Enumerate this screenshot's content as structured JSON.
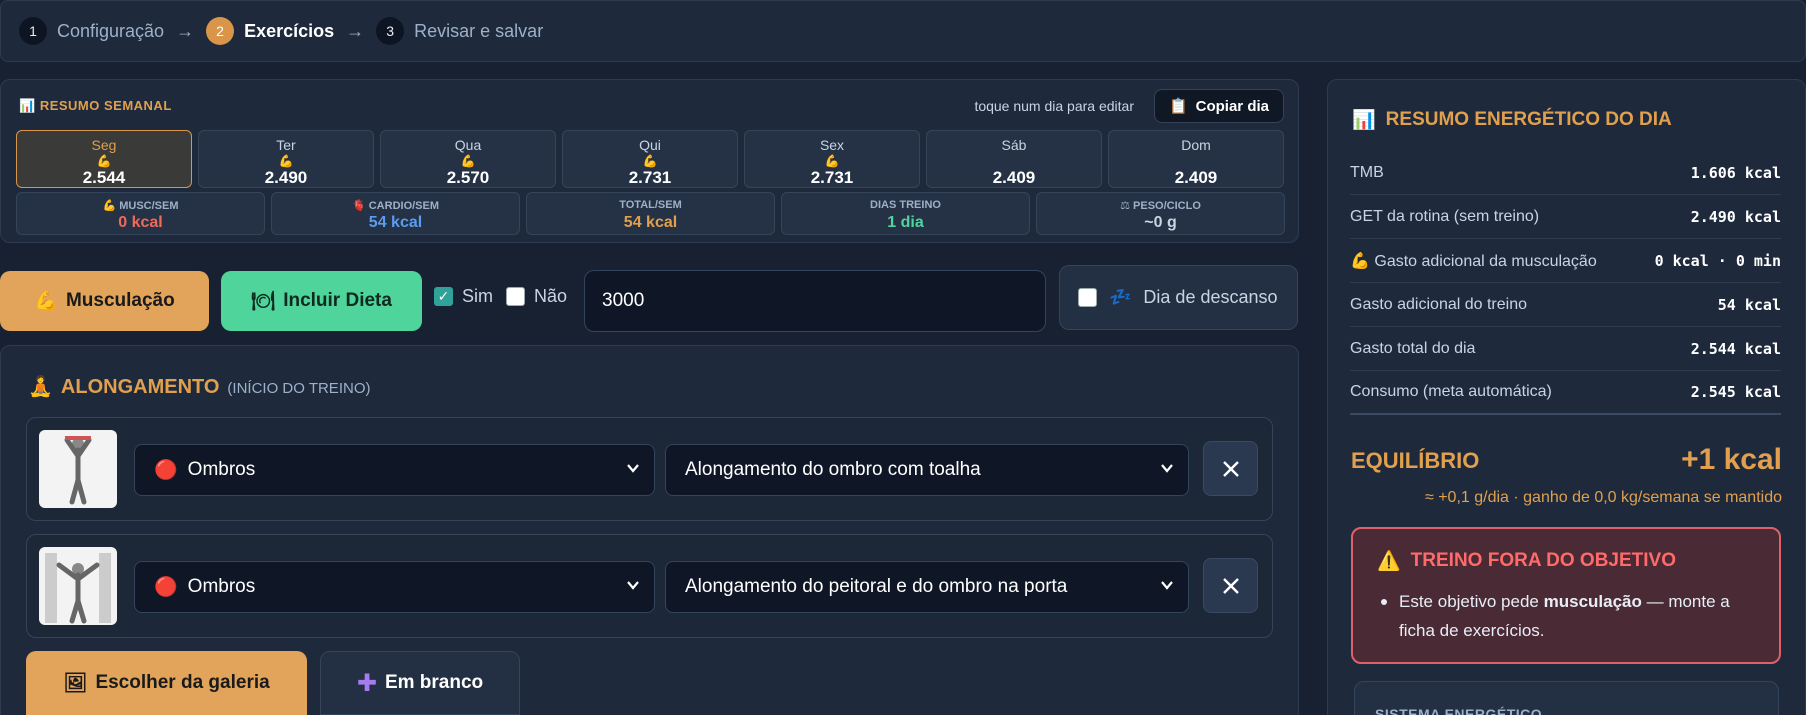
{
  "stepper": {
    "steps": [
      {
        "num": "1",
        "label": "Configuração"
      },
      {
        "num": "2",
        "label": "Exercícios"
      },
      {
        "num": "3",
        "label": "Revisar e salvar"
      }
    ],
    "arrow": "→"
  },
  "week": {
    "title": "RESUMO SEMANAL",
    "hint": "toque num dia para editar",
    "copy_label": "Copiar dia",
    "days": [
      {
        "name": "Seg",
        "kcal": "2.544",
        "has_icon": true
      },
      {
        "name": "Ter",
        "kcal": "2.490",
        "has_icon": true
      },
      {
        "name": "Qua",
        "kcal": "2.570",
        "has_icon": true
      },
      {
        "name": "Qui",
        "kcal": "2.731",
        "has_icon": true
      },
      {
        "name": "Sex",
        "kcal": "2.731",
        "has_icon": true
      },
      {
        "name": "Sáb",
        "kcal": "2.409",
        "has_icon": false
      },
      {
        "name": "Dom",
        "kcal": "2.409",
        "has_icon": false
      }
    ],
    "stats": [
      {
        "label": "MUSC/SEM",
        "value": "0 kcal",
        "color": "#f06a5a"
      },
      {
        "label": "CARDIO/SEM",
        "value": "54 kcal",
        "color": "#5a9cf0"
      },
      {
        "label": "TOTAL/SEM",
        "value": "54 kcal",
        "color": "#e0a04d"
      },
      {
        "label": "DIAS TREINO",
        "value": "1 dia",
        "color": "#4fd49c"
      },
      {
        "label": "PESO/CICLO",
        "value": "~0 g",
        "color": "#c9d4e2"
      }
    ]
  },
  "controls": {
    "musc_label": "Musculação",
    "diet_label": "Incluir Dieta",
    "yes_label": "Sim",
    "no_label": "Não",
    "calories_value": "3000",
    "rest_label": "Dia de descanso"
  },
  "exercise": {
    "title": "ALONGAMENTO",
    "subtitle": "(INÍCIO DO TREINO)",
    "rows": [
      {
        "group": "Ombros",
        "name": "Alongamento do ombro com toalha"
      },
      {
        "group": "Ombros",
        "name": "Alongamento do peitoral e do ombro na porta"
      }
    ],
    "gallery_label": "Escolher da galeria",
    "blank_label": "Em branco"
  },
  "energy": {
    "title": "RESUMO ENERGÉTICO DO DIA",
    "rows": [
      {
        "label": "TMB",
        "value": "1.606 kcal"
      },
      {
        "label": "GET da rotina (sem treino)",
        "value": "2.490 kcal"
      },
      {
        "label": "Gasto adicional da musculação",
        "value": "0 kcal · 0 min"
      },
      {
        "label": "Gasto adicional do treino",
        "value": "54 kcal"
      },
      {
        "label": "Gasto total do dia",
        "value": "2.544 kcal"
      },
      {
        "label": "Consumo (meta automática)",
        "value": "2.545 kcal"
      }
    ],
    "balance_label": "EQUILÍBRIO",
    "balance_value": "+1 kcal",
    "balance_note": "≈ +0,1 g/dia · ganho de 0,0 kg/semana se mantido",
    "warning_title": "TREINO FORA DO OBJETIVO",
    "warning_text_pre": "Este objetivo pede ",
    "warning_text_bold": "musculação",
    "warning_text_post": " — monte a ficha de exercícios.",
    "system_title": "SISTEMA ENERGÉTICO"
  },
  "colors": {
    "accent": "#e0a04d",
    "green": "#4fd49c",
    "danger": "#ff6b6b",
    "bg": "#172131"
  }
}
